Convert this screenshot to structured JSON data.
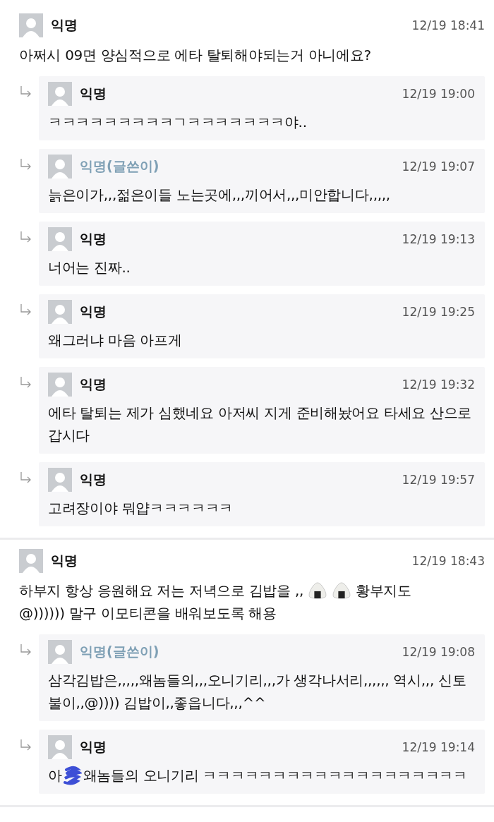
{
  "threads": [
    {
      "author": "익명",
      "is_writer": false,
      "time": "12/19 18:41",
      "parts": [
        {
          "kind": "text",
          "text": "아쩌시 09면 양심적으로 에타 탈퇴해야되는거 아니에요?"
        }
      ],
      "replies": [
        {
          "author": "익명",
          "is_writer": false,
          "time": "12/19 19:00",
          "parts": [
            {
              "kind": "text",
              "text": "ㅋㅋㅋㅋㅋㅋㅋㅋㅋㄱㅋㅋㅋㅋㅋㅋㅋ야.."
            }
          ]
        },
        {
          "author": "익명(글쓴이)",
          "is_writer": true,
          "time": "12/19 19:07",
          "parts": [
            {
              "kind": "text",
              "text": "늙은이가,,,젊은이들 노는곳에,,,끼어서,,,미안합니다,,,,,"
            }
          ]
        },
        {
          "author": "익명",
          "is_writer": false,
          "time": "12/19 19:13",
          "parts": [
            {
              "kind": "text",
              "text": "너어는 진짜.."
            }
          ]
        },
        {
          "author": "익명",
          "is_writer": false,
          "time": "12/19 19:25",
          "parts": [
            {
              "kind": "text",
              "text": "왜그러냐 마음 아프게"
            }
          ]
        },
        {
          "author": "익명",
          "is_writer": false,
          "time": "12/19 19:32",
          "parts": [
            {
              "kind": "text",
              "text": "에타 탈퇴는 제가 심했네요 아저씨 지게 준비해놨어요 타세요 산으로갑시다"
            }
          ]
        },
        {
          "author": "익명",
          "is_writer": false,
          "time": "12/19 19:57",
          "parts": [
            {
              "kind": "text",
              "text": "고려장이야 뭐얍ㅋㅋㅋㅋㅋㅋ"
            }
          ]
        }
      ]
    },
    {
      "author": "익명",
      "is_writer": false,
      "time": "12/19 18:43",
      "parts": [
        {
          "kind": "text",
          "text": "하부지 항상 응원해요 저는 저녁으로 김밥을 ,,"
        },
        {
          "kind": "onigiri"
        },
        {
          "kind": "onigiri"
        },
        {
          "kind": "text",
          "text": "황부지도"
        },
        {
          "kind": "text",
          "text": "@)))))) 말구 이모티콘을 배워보도록 해용"
        }
      ],
      "replies": [
        {
          "author": "익명(글쓴이)",
          "is_writer": true,
          "time": "12/19 19:08",
          "parts": [
            {
              "kind": "text",
              "text": "삼각김밥은,,,,,왜놈들의,,,오니기리,,,가 생각나서리,,,,,, 역시,,, 신토불이,,@)))) 김밥이,,좋읍니다,,,^^"
            }
          ]
        },
        {
          "author": "익명",
          "is_writer": false,
          "time": "12/19 19:14",
          "parts": [
            {
              "kind": "text",
              "text": "아"
            },
            {
              "kind": "scribble"
            },
            {
              "kind": "text",
              "text": " 왜놈들의 오니기리 ㅋㅋㅋㅋㅋㅋㅋㅋㅋㅋㅋㅋㅋㅋㅋㅋㅋㅋㅋ"
            }
          ]
        }
      ]
    }
  ]
}
